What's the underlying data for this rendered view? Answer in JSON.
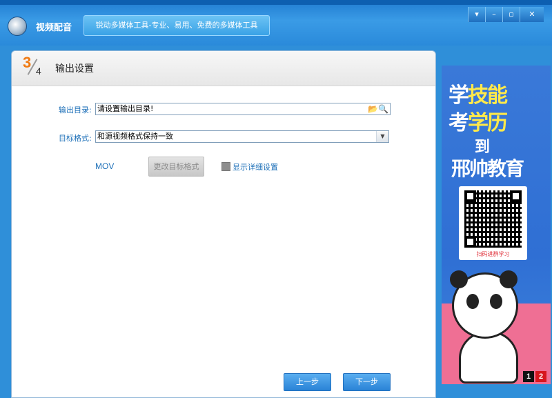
{
  "window": {
    "title": "视频配音",
    "slogan": "锐动多媒体工具-专业、易用、免费的多媒体工具",
    "controls": {
      "menu": "▾",
      "minimize": "–",
      "maximize": "▫",
      "close": "✕"
    }
  },
  "step": {
    "current": "3",
    "total": "4",
    "title": "输出设置"
  },
  "form": {
    "output_dir_label": "输出目录:",
    "output_dir_value": "请设置输出目录!",
    "target_format_label": "目标格式:",
    "target_format_value": "和源视频格式保持一致",
    "format_name": "MOV",
    "change_format_button": "更改目标格式",
    "show_details_label": "显示详细设置"
  },
  "nav": {
    "prev_button": "上一步",
    "next_button": "下一步"
  },
  "ad": {
    "line1_a": "学",
    "line1_b": "技能",
    "line2_a": "考",
    "line2_b": "学历",
    "to": "到",
    "brand": "邢帅教育",
    "qr_caption": "扫码进群学习",
    "pages": [
      "1",
      "2"
    ]
  },
  "colors": {
    "accent": "#2f8fd9",
    "label_blue": "#1c6fb8",
    "step_orange": "#f07a12",
    "ad_yellow": "#ffe94a",
    "ad_pink": "#ef6f94"
  }
}
